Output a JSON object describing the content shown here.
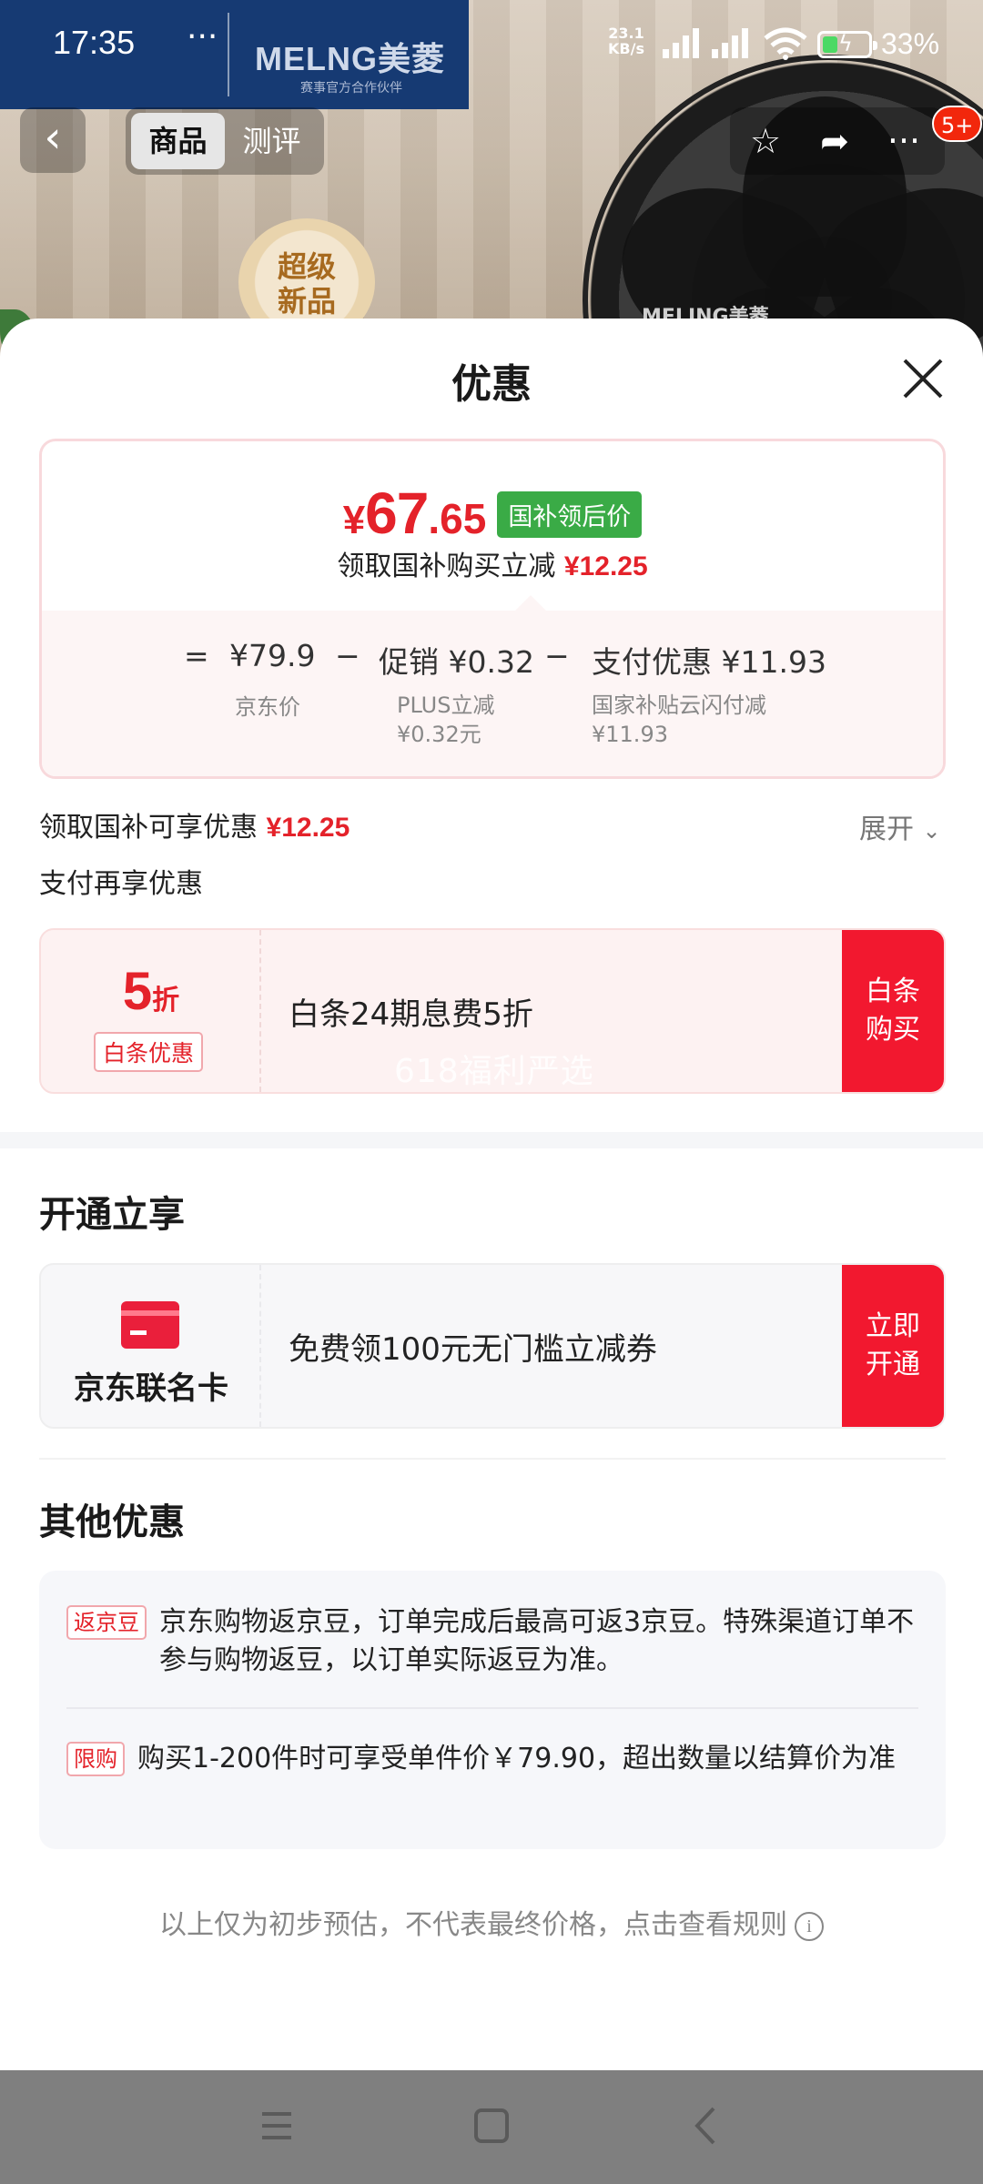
{
  "status_bar": {
    "time": "17:35",
    "dots": "···",
    "speed_value": "23.1",
    "speed_unit": "KB/s",
    "battery": "33%"
  },
  "background": {
    "brand_logo": "MELNG美菱",
    "brand_sub": "赛事官方合作伙伴",
    "badge_line1": "超级",
    "badge_line2": "新品",
    "fan_label": "MELING美菱"
  },
  "nav": {
    "back_icon": "chevron-left-icon",
    "tabs": [
      {
        "label": "商品",
        "active": true
      },
      {
        "label": "测评",
        "active": false
      }
    ],
    "message_badge": "5+"
  },
  "sheet": {
    "title": "优惠"
  },
  "price_card": {
    "currency": "¥",
    "price_int": "67",
    "price_dec": ".65",
    "tag": "国补领后价",
    "subtitle": "领取国补购买立减",
    "subtitle_amount": "¥12.25",
    "formula": {
      "eq": "=",
      "base_value": "¥79.9",
      "base_label": "京东价",
      "minus1": "−",
      "promo_value": "促销 ¥0.32",
      "promo_label1": "PLUS立减",
      "promo_label2": "¥0.32元",
      "minus2": "−",
      "pay_value": "支付优惠 ¥11.93",
      "pay_label1": "国家补贴云闪付减",
      "pay_label2": "¥11.93"
    }
  },
  "subsidy_row": {
    "label": "领取国补可享优惠",
    "amount": "¥12.25",
    "expand": "展开"
  },
  "pay_section": {
    "title": "支付再享优惠"
  },
  "baitiao_offer": {
    "discount_num": "5",
    "discount_unit": "折",
    "tag": "白条优惠",
    "description": "白条24期息费5折",
    "watermark": "618福利严选",
    "cta": "白条购买"
  },
  "open_section": {
    "title": "开通立享"
  },
  "card_offer": {
    "icon": "credit-card-icon",
    "name": "京东联名卡",
    "description": "免费领100元无门槛立减券",
    "cta": "立即开通"
  },
  "other_section": {
    "title": "其他优惠",
    "items": [
      {
        "tag": "返京豆",
        "text": "京东购物返京豆，订单完成后最高可返3京豆。特殊渠道订单不参与购物返豆，以订单实际返豆为准。"
      },
      {
        "tag": "限购",
        "text": "购买1-200件时可享受单件价￥79.90，超出数量以结算价为准"
      }
    ]
  },
  "disclaimer": "以上仅为初步预估，不代表最终价格，点击查看规则",
  "colors": {
    "accent_red": "#e4222a",
    "cta_red": "#f2182f",
    "tag_green": "#3aab46"
  }
}
